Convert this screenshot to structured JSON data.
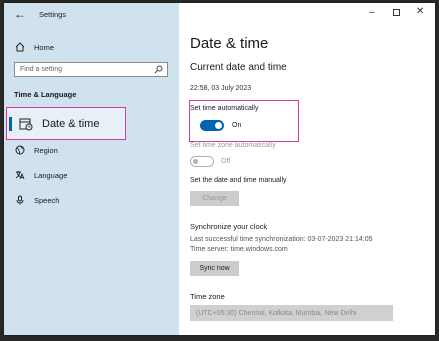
{
  "window": {
    "title": "Settings",
    "back_icon": "back-arrow-icon",
    "controls": [
      "minimize-icon",
      "maximize-icon",
      "close-icon"
    ]
  },
  "sidebar": {
    "home": "Home",
    "search_placeholder": "Find a setting",
    "section": "Time & Language",
    "items": [
      {
        "label": "Date & time",
        "icon": "calendar-clock-icon",
        "selected": true
      },
      {
        "label": "Region",
        "icon": "globe-icon"
      },
      {
        "label": "Language",
        "icon": "language-icon"
      },
      {
        "label": "Speech",
        "icon": "microphone-icon"
      }
    ]
  },
  "main": {
    "title": "Date & time",
    "current_heading": "Current date and time",
    "current_value": "22:58, 03 July 2023",
    "auto_time_label": "Set time automatically",
    "auto_time_state": "On",
    "auto_zone_label": "Set time zone automatically",
    "auto_zone_state": "Off",
    "manual_label": "Set the date and time manually",
    "change_button": "Change",
    "sync_heading": "Synchronize your clock",
    "last_sync": "Last successful time synchronization: 03-07-2023 21:14:05",
    "time_server": "Time server: time.windows.com",
    "sync_button": "Sync now",
    "timezone_heading": "Time zone",
    "timezone_value": "(UTC+05:30) Chennai, Kolkata, Mumbai, New Delhi"
  },
  "colors": {
    "accent": "#0063b1",
    "highlight": "#d23c9c",
    "sidebar_bg": "#cfe2ee"
  }
}
